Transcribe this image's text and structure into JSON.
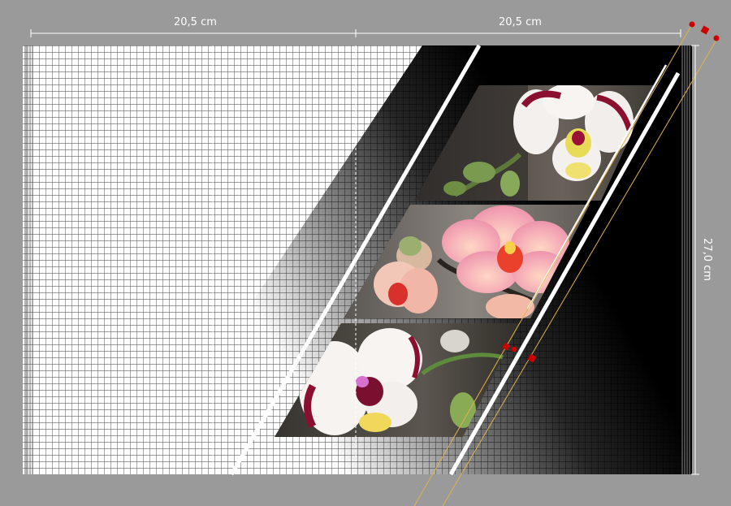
{
  "dimensions": {
    "width_left": "20,5 cm",
    "width_right": "20,5 cm",
    "height": "27,0 cm"
  },
  "panels": [
    {
      "name": "orchid-photo-top",
      "subject": "white orchid with magenta edges"
    },
    {
      "name": "orchid-photo-middle",
      "subject": "pink orchid with red lip"
    },
    {
      "name": "orchid-photo-bottom",
      "subject": "white orchid with magenta spots"
    }
  ],
  "colors": {
    "background": "#9a9a9a",
    "grid_line": "#3a3a3a",
    "canvas_dark": "#000000",
    "stripe": "#ffffff",
    "guide": "#e0b24a",
    "handle": "#cc0000"
  }
}
